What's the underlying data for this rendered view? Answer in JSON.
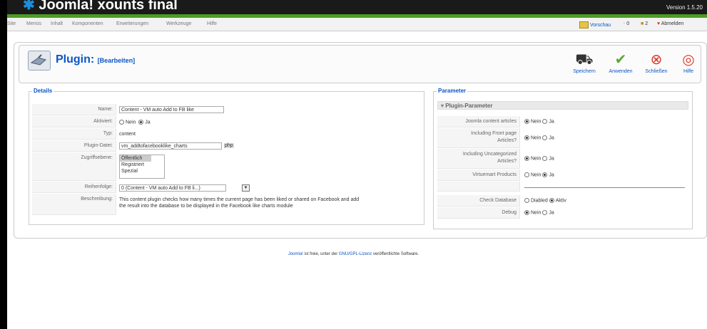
{
  "header": {
    "logo_prefix": "Joomla!",
    "site_title": "xounts final",
    "version": "Version 1.5.20"
  },
  "menu": {
    "items": [
      "Site",
      "Menüs",
      "Inhalt",
      "Komponenten",
      "Erweiterungen",
      "Werkzeuge",
      "Hilfe"
    ],
    "preview": "Vorschau",
    "messages_count": "0",
    "users_count": "2",
    "logout": "Abmelden"
  },
  "toolbar": {
    "title": "Plugin:",
    "title_suffix": "[Bearbeiten]",
    "save": "Speichern",
    "apply": "Anwenden",
    "close": "Schließen",
    "help": "Hilfe"
  },
  "details": {
    "legend": "Details",
    "name_label": "Name:",
    "name_value": "Content - VM auto Add to FB like",
    "enabled_label": "Aktiviert:",
    "enabled_no": "Nein",
    "enabled_yes": "Ja",
    "type_label": "Typ:",
    "type_value": "content",
    "file_label": "Plugin-Datei:",
    "file_value": "vm_addtofacebooklike_charts",
    "file_ext": "php",
    "access_label": "Zugriffsebene:",
    "access_options": [
      "Öffentlich",
      "Registriert",
      "Spezial"
    ],
    "order_label": "Reihenfolge:",
    "order_value": "0 (Content - VM auto Add to FB li...)",
    "desc_label": "Beschreibung:",
    "desc_line1": "This content plugin checks how many times the current page has been liked or shared on Facebook and add",
    "desc_line2": "the result into the database to be displayed in the Facebook like charts module"
  },
  "params": {
    "legend": "Parameter",
    "section_title": "Plugin-Parameter",
    "rows": [
      {
        "label": "Joomla content articles",
        "opt1": "Nein",
        "opt2": "Ja"
      },
      {
        "label1": "Including Front page",
        "label2": "Articles?",
        "opt1": "Nein",
        "opt2": "Ja"
      },
      {
        "label1": "Including Uncategorized",
        "label2": "Articles?",
        "opt1": "Nein",
        "opt2": "Ja"
      },
      {
        "label": "Virtuemart Products",
        "opt1": "Nein",
        "opt2": "Ja"
      },
      {
        "label": "Check Database",
        "opt1": "Diabled",
        "opt2": "Aktiv"
      },
      {
        "label": "Debug",
        "opt1": "Nein",
        "opt2": "Ja"
      }
    ]
  },
  "footer": {
    "joomla": "Joomla!",
    "text1": " ist freie, unter der ",
    "license": "GNU/GPL-Lizenz",
    "text2": " veröffentlichte Software."
  }
}
